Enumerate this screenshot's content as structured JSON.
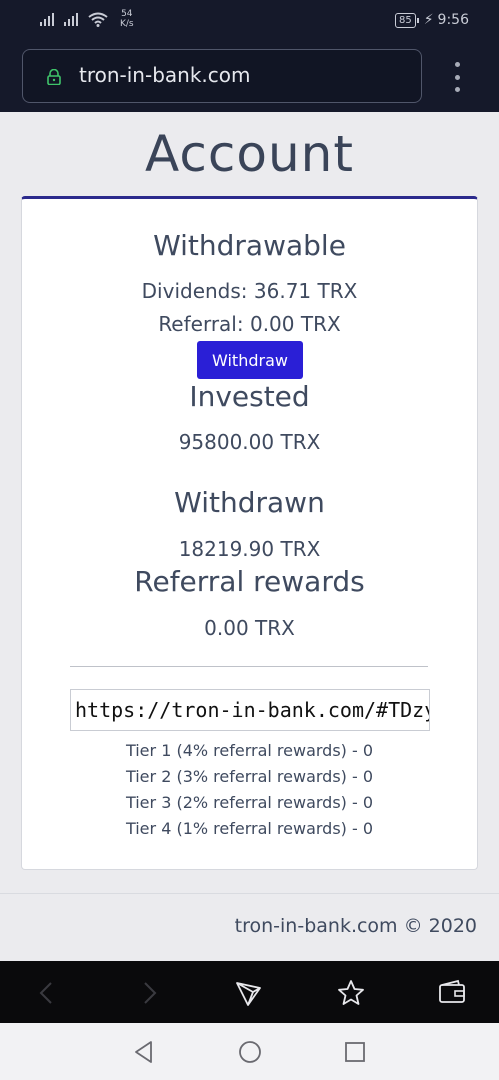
{
  "status_bar": {
    "net_speed_value": "54",
    "net_speed_unit": "K/s",
    "battery": "85",
    "time": "9:56"
  },
  "browser": {
    "url": "tron-in-bank.com"
  },
  "page": {
    "title": "Account"
  },
  "withdrawable": {
    "heading": "Withdrawable",
    "dividends": "Dividends: 36.71 TRX",
    "referral": "Referral: 0.00 TRX",
    "button_label": "Withdraw"
  },
  "invested": {
    "heading": "Invested",
    "value": "95800.00 TRX"
  },
  "withdrawn": {
    "heading": "Withdrawn",
    "value": "18219.90 TRX"
  },
  "referral_rewards": {
    "heading": "Referral rewards",
    "value": "0.00 TRX"
  },
  "referral_link": {
    "value": "https://tron-in-bank.com/#TDzy"
  },
  "tiers": [
    "Tier 1 (4% referral rewards) - 0",
    "Tier 2 (3% referral rewards) - 0",
    "Tier 3 (2% referral rewards) - 0",
    "Tier 4 (1% referral rewards) - 0"
  ],
  "footer": {
    "text": "tron-in-bank.com © 2020"
  },
  "colors": {
    "accent": "#2a1fd6",
    "card_top_border": "#2b2a8c",
    "browser_bar": "#15192a"
  },
  "icons": [
    "signal-icon",
    "wifi-icon",
    "battery-icon",
    "charging-icon",
    "lock-icon",
    "menu-dots-icon",
    "back-arrow-icon",
    "forward-arrow-icon",
    "tron-icon",
    "star-icon",
    "wallet-icon",
    "android-back-icon",
    "android-home-icon",
    "android-recents-icon"
  ]
}
